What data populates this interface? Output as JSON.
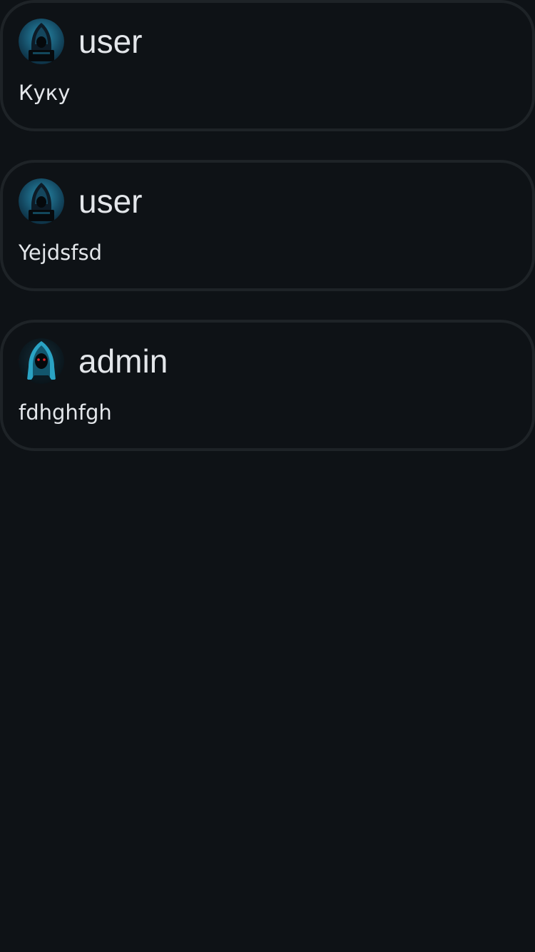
{
  "posts": [
    {
      "author": "user",
      "text": "Куку",
      "avatar_icon": "hooded-hacker-laptop-avatar",
      "avatar_accent": "#1b6f8f"
    },
    {
      "author": "user",
      "text": "Yejdsfsd",
      "avatar_icon": "hooded-hacker-laptop-avatar",
      "avatar_accent": "#1b6f8f"
    },
    {
      "author": "admin",
      "text": "fdhghfgh",
      "avatar_icon": "hooded-figure-red-eyes-avatar",
      "avatar_accent": "#2aa3c4",
      "eye_color": "#e0242a"
    }
  ],
  "theme": {
    "background": "#0e1216",
    "card_border": "#1e2327",
    "text": "#e3e6ea"
  }
}
